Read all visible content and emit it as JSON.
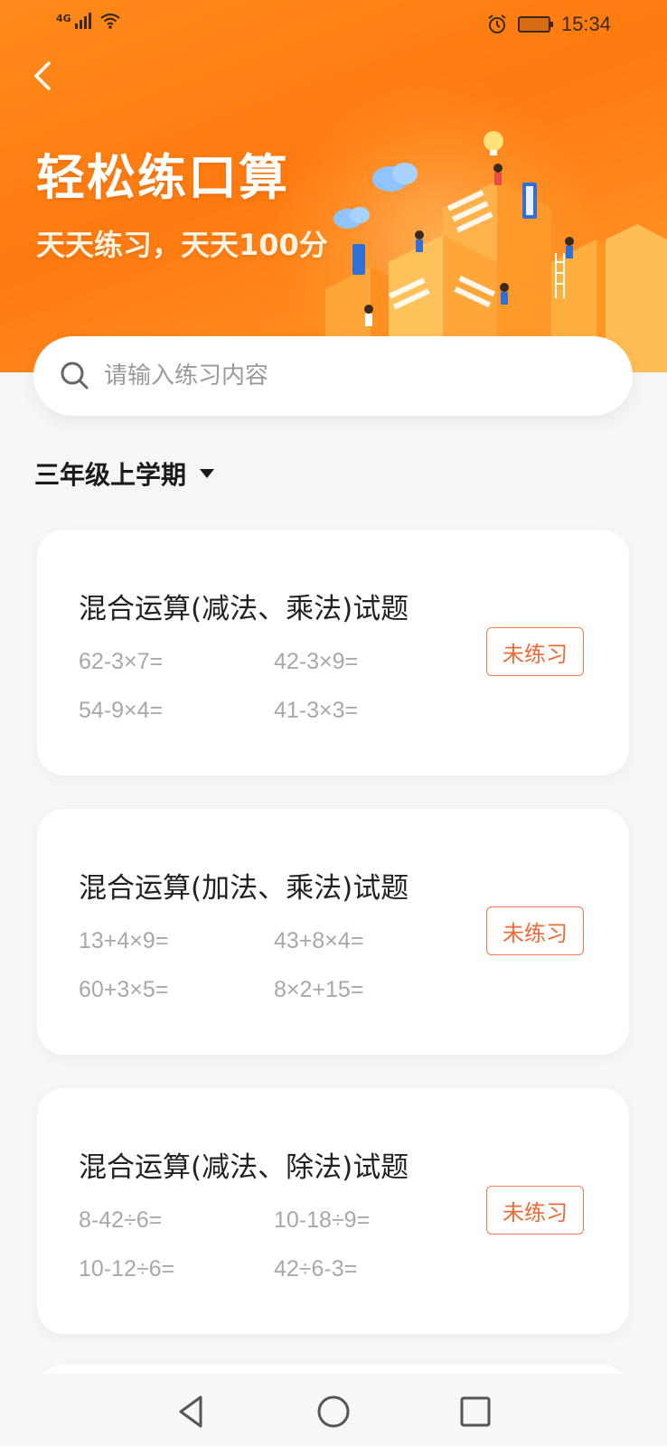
{
  "status_bar": {
    "network": "4G",
    "time": "15:34"
  },
  "header": {
    "title": "轻松练口算",
    "subtitle": "天天练习，天天100分"
  },
  "search": {
    "placeholder": "请输入练习内容",
    "value": ""
  },
  "grade": {
    "selected": "三年级上学期"
  },
  "cards": [
    {
      "title": "混合运算(减法、乘法)试题",
      "questions": [
        "62-3×7=",
        "42-3×9=",
        "54-9×4=",
        "41-3×3="
      ],
      "status": "未练习"
    },
    {
      "title": "混合运算(加法、乘法)试题",
      "questions": [
        "13+4×9=",
        "43+8×4=",
        "60+3×5=",
        "8×2+15="
      ],
      "status": "未练习"
    },
    {
      "title": "混合运算(减法、除法)试题",
      "questions": [
        "8-42÷6=",
        "10-18÷9=",
        "10-12÷6=",
        "42÷6-3="
      ],
      "status": "未练习"
    }
  ],
  "colors": {
    "brand_orange": "#ff7a10",
    "status_accent": "#ee6a36",
    "question_gray": "#a8a8a8"
  },
  "icons": {
    "back": "chevron-left-icon",
    "search": "search-icon",
    "grade_dropdown": "caret-down-icon",
    "nav_back": "triangle-back-icon",
    "nav_home": "circle-home-icon",
    "nav_recents": "square-recents-icon"
  }
}
